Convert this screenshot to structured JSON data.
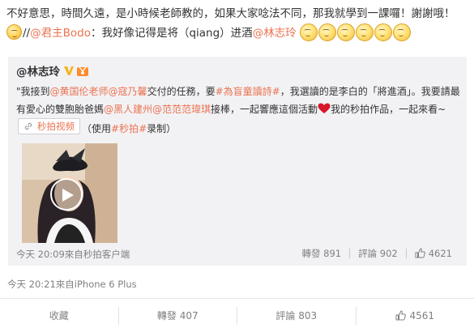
{
  "post": {
    "text_part1": "不好意思，時間久遠，是小時候老師教的，如果大家唸法不同，那我就學到一課囉！謝謝哦！",
    "mention_sep": "//",
    "mention_user": "@君主Bodo",
    "text_part2": "：我好像记得是将（qiang）进酒",
    "mention_user2": "@林志玲",
    "emoticon_count": 6,
    "meta": "今天 20:21來自iPhone 6 Plus"
  },
  "repost": {
    "author": "@林志玲",
    "t1": "\"我接到",
    "m1": "@黄国伦老师",
    "m2": "@寇乃馨",
    "t2": "交付的任務，要",
    "tag1": "#為盲童讀詩#",
    "t3": "，我選讀的是李白的「將進酒」。我要請最有愛心的雙胞胎爸媽",
    "m3": "@黑人建州",
    "m4": "@范范范瑋琪",
    "t4": "接棒，一起響應這個活動",
    "t5": "我的秒拍作品，一起來看~",
    "video_chip": "秒拍视频",
    "t6": "（使用",
    "tag2": "#秒拍#",
    "t7": "录制）",
    "meta": "今天 20:09來自秒拍客户端",
    "repost_label": "轉發 891",
    "comment_label": "評論 902",
    "like_count": "4621"
  },
  "bottom": {
    "collect": "收藏",
    "repost": "轉發 407",
    "comment": "評論 803",
    "like": "4561"
  },
  "colors": {
    "link": "#eb7350",
    "muted": "#808080",
    "repost_bg": "#f2f2f5"
  }
}
